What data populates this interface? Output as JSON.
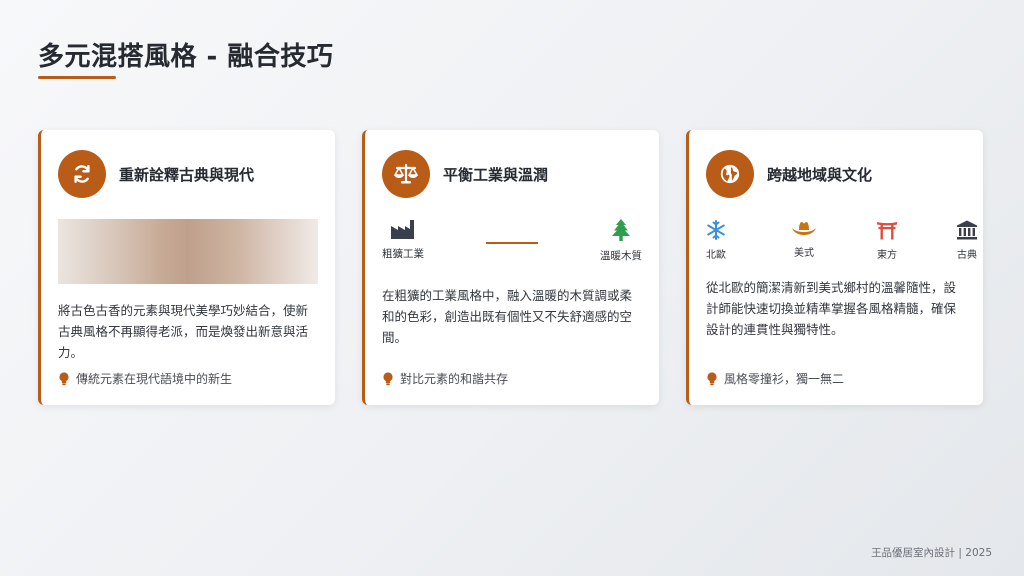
{
  "page": {
    "title": "多元混搭風格 - 融合技巧",
    "footer": "王品優居室內設計 | 2025"
  },
  "colors": {
    "accent": "#b85c18",
    "factory": "#3a3f4b",
    "tree": "#2e9e4f",
    "snow": "#3b8fe0",
    "hat": "#c9740f",
    "torii": "#e34b3c",
    "temple": "#3a3f4b"
  },
  "cards": [
    {
      "icon": "sync-icon",
      "title": "重新詮釋古典與現代",
      "description": "將古色古香的元素與現代美學巧妙結合，使新古典風格不再顯得老派，而是煥發出新意與活力。",
      "tip": "傳統元素在現代語境中的新生"
    },
    {
      "icon": "balance-scale-icon",
      "title": "平衡工業與溫潤",
      "compare": {
        "left_label": "粗獷工業",
        "left_icon": "factory-icon",
        "right_label": "溫暖木質",
        "right_icon": "tree-icon"
      },
      "description": "在粗獷的工業風格中，融入溫暖的木質調或柔和的色彩，創造出既有個性又不失舒適感的空間。",
      "tip": "對比元素的和諧共存"
    },
    {
      "icon": "globe-icon",
      "title": "跨越地域與文化",
      "regions": [
        {
          "label": "北歐",
          "icon": "snowflake-icon"
        },
        {
          "label": "美式",
          "icon": "cowboy-hat-icon"
        },
        {
          "label": "東方",
          "icon": "torii-gate-icon"
        },
        {
          "label": "古典",
          "icon": "classical-building-icon"
        }
      ],
      "description": "從北歐的簡潔清新到美式鄉村的溫馨隨性，設計師能快速切換並精準掌握各風格精髓，確保設計的連貫性與獨特性。",
      "tip": "風格零撞衫，獨一無二"
    }
  ]
}
